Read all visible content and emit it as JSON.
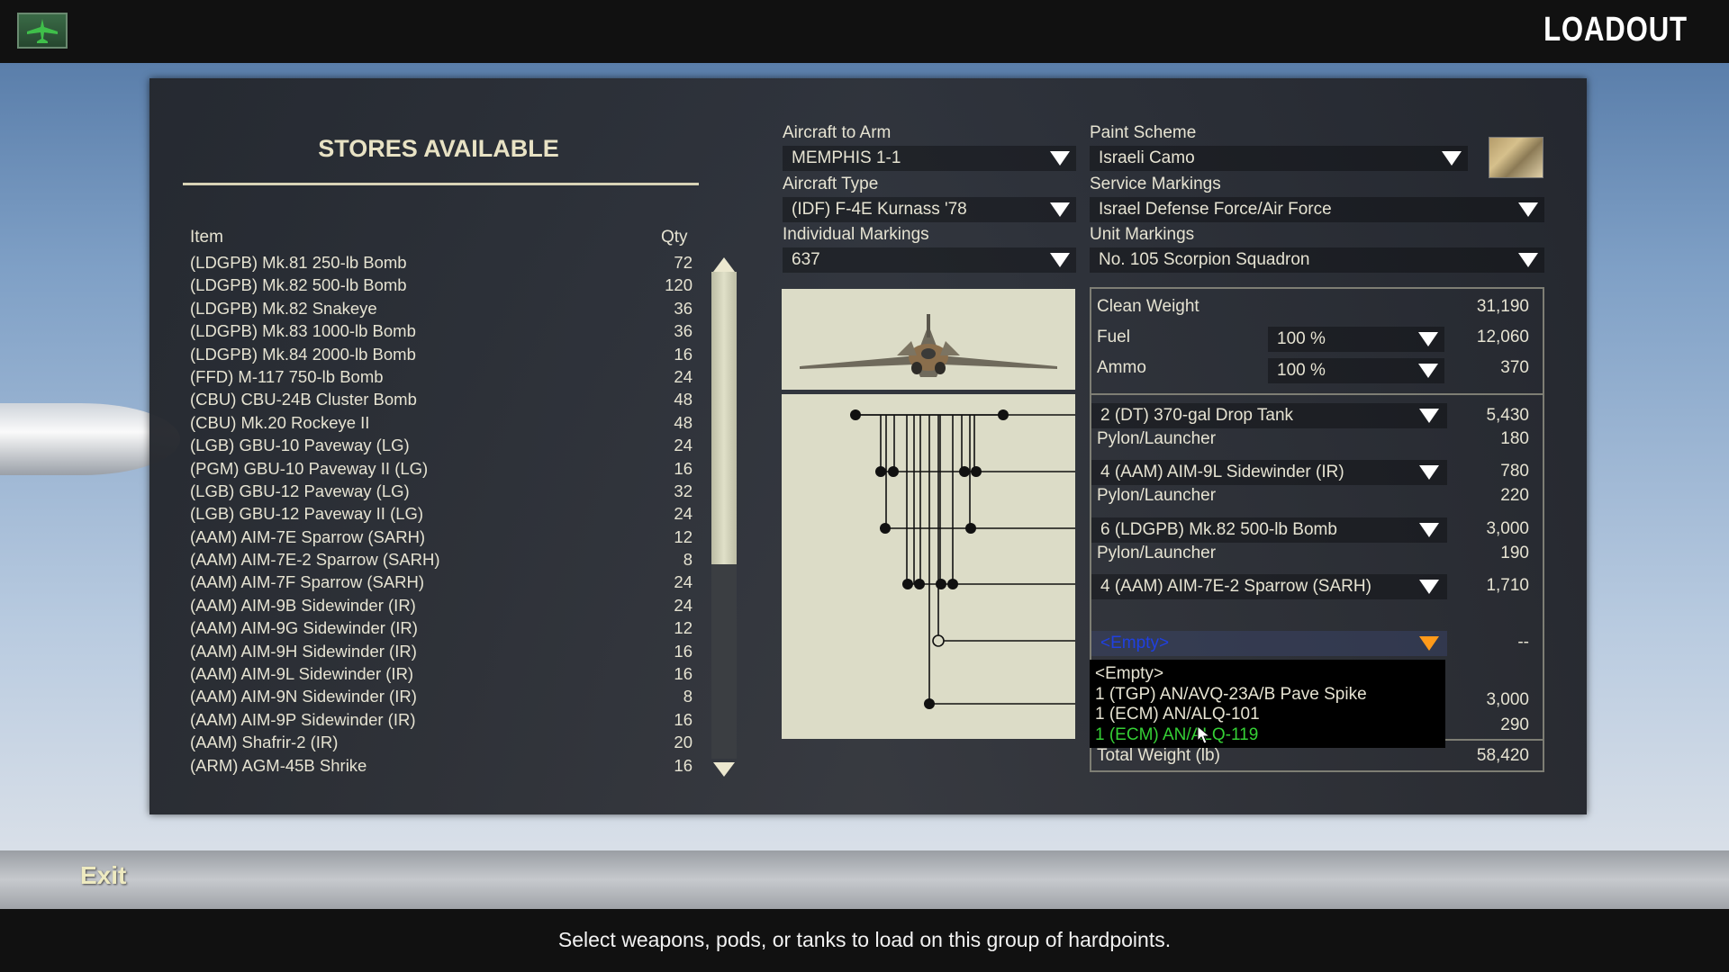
{
  "header": {
    "title": "LOADOUT",
    "home_icon": "aircraft-icon"
  },
  "stores": {
    "title": "STORES AVAILABLE",
    "col_item": "Item",
    "col_qty": "Qty",
    "items": [
      {
        "name": "(LDGPB) Mk.81 250-lb Bomb",
        "qty": "72"
      },
      {
        "name": "(LDGPB) Mk.82 500-lb Bomb",
        "qty": "120"
      },
      {
        "name": "(LDGPB) Mk.82 Snakeye",
        "qty": "36"
      },
      {
        "name": "(LDGPB) Mk.83 1000-lb Bomb",
        "qty": "36"
      },
      {
        "name": "(LDGPB) Mk.84 2000-lb Bomb",
        "qty": "16"
      },
      {
        "name": "(FFD) M-117 750-lb Bomb",
        "qty": "24"
      },
      {
        "name": "(CBU) CBU-24B Cluster Bomb",
        "qty": "48"
      },
      {
        "name": "(CBU) Mk.20 Rockeye II",
        "qty": "48"
      },
      {
        "name": "(LGB) GBU-10 Paveway (LG)",
        "qty": "24"
      },
      {
        "name": "(PGM) GBU-10 Paveway II (LG)",
        "qty": "16"
      },
      {
        "name": "(LGB) GBU-12 Paveway (LG)",
        "qty": "32"
      },
      {
        "name": "(LGB) GBU-12 Paveway II (LG)",
        "qty": "24"
      },
      {
        "name": "(AAM) AIM-7E Sparrow (SARH)",
        "qty": "12"
      },
      {
        "name": "(AAM) AIM-7E-2 Sparrow (SARH)",
        "qty": "8"
      },
      {
        "name": "(AAM) AIM-7F Sparrow (SARH)",
        "qty": "24"
      },
      {
        "name": "(AAM) AIM-9B Sidewinder (IR)",
        "qty": "24"
      },
      {
        "name": "(AAM) AIM-9G Sidewinder (IR)",
        "qty": "12"
      },
      {
        "name": "(AAM) AIM-9H Sidewinder (IR)",
        "qty": "16"
      },
      {
        "name": "(AAM) AIM-9L Sidewinder (IR)",
        "qty": "16"
      },
      {
        "name": "(AAM) AIM-9N Sidewinder (IR)",
        "qty": "8"
      },
      {
        "name": "(AAM) AIM-9P Sidewinder (IR)",
        "qty": "16"
      },
      {
        "name": "(AAM) Shafrir-2 (IR)",
        "qty": "20"
      },
      {
        "name": "(ARM) AGM-45B Shrike",
        "qty": "16"
      }
    ]
  },
  "config": {
    "aircraft_to_arm_label": "Aircraft to Arm",
    "aircraft_to_arm": "MEMPHIS 1-1",
    "aircraft_type_label": "Aircraft Type",
    "aircraft_type": "(IDF) F-4E Kurnass '78",
    "individual_markings_label": "Individual Markings",
    "individual_markings": "637",
    "paint_scheme_label": "Paint Scheme",
    "paint_scheme": "Israeli Camo",
    "service_markings_label": "Service Markings",
    "service_markings": "Israel Defense Force/Air Force",
    "unit_markings_label": "Unit Markings",
    "unit_markings": "No. 105 Scorpion Squadron"
  },
  "weights": {
    "clean_weight_label": "Clean Weight",
    "clean_weight": "31,190",
    "fuel_label": "Fuel",
    "fuel_pct": "100 %",
    "fuel": "12,060",
    "ammo_label": "Ammo",
    "ammo_pct": "100 %",
    "ammo": "370",
    "pylon_label": "Pylon/Launcher",
    "hardpoints": [
      {
        "store": "2 (DT) 370-gal Drop Tank",
        "weight": "5,430",
        "pylon": "180"
      },
      {
        "store": "4 (AAM) AIM-9L Sidewinder (IR)",
        "weight": "780",
        "pylon": "220"
      },
      {
        "store": "6 (LDGPB) Mk.82 500-lb Bomb",
        "weight": "3,000",
        "pylon": "190"
      },
      {
        "store": "4 (AAM) AIM-7E-2 Sparrow (SARH)",
        "weight": "1,710"
      }
    ],
    "empty_selected": "<Empty>",
    "empty_weight": "--",
    "hidden_weight": "3,000",
    "hidden_pylon": "290",
    "total_label": "Total Weight (lb)",
    "total": "58,420"
  },
  "dropdown_popup": {
    "options": [
      "<Empty>",
      "1 (TGP) AN/AVQ-23A/B Pave Spike",
      "1 (ECM) AN/ALQ-101",
      "1 (ECM) AN/ALQ-119"
    ],
    "highlighted": "1 (ECM) AN/ALQ-119"
  },
  "footer": {
    "exit_label": "Exit",
    "status": "Select weapons, pods, or tanks to load on this group of hardpoints."
  },
  "colors": {
    "accent_text": "#e8e2c4",
    "highlight_green": "#35d035",
    "empty_blue": "#2040e0",
    "dropdown_arrow": "#ffffff",
    "active_arrow": "#ff9a1a"
  }
}
